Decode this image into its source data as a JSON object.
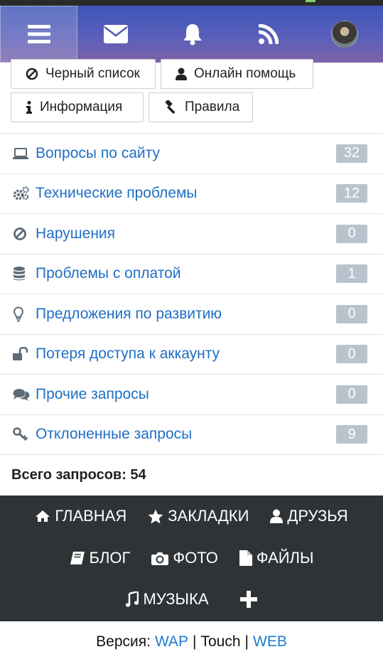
{
  "topbar": {
    "items": [
      {
        "icon": "menu-icon",
        "active": true
      },
      {
        "icon": "envelope-icon"
      },
      {
        "icon": "bell-icon"
      },
      {
        "icon": "rss-icon"
      },
      {
        "icon": "avatar"
      }
    ],
    "gradient_start": "#3d55b8",
    "gradient_end": "#7d63a8"
  },
  "buttons": {
    "blacklist": "Черный список",
    "online_help": "Онлайн помощь",
    "info": "Информация",
    "rules": "Правила"
  },
  "categories": [
    {
      "label": "Вопросы по сайту",
      "count": "32",
      "icon": "laptop-icon"
    },
    {
      "label": "Технические проблемы",
      "count": "12",
      "icon": "gears-icon"
    },
    {
      "label": "Нарушения",
      "count": "0",
      "icon": "ban-icon"
    },
    {
      "label": "Проблемы с оплатой",
      "count": "1",
      "icon": "database-icon"
    },
    {
      "label": "Предложения по развитию",
      "count": "0",
      "icon": "lightbulb-icon"
    },
    {
      "label": "Потеря доступа к аккаунту",
      "count": "0",
      "icon": "unlock-icon"
    },
    {
      "label": "Прочие запросы",
      "count": "0",
      "icon": "comments-icon"
    },
    {
      "label": "Отклоненные запросы",
      "count": "9",
      "icon": "key-icon"
    }
  ],
  "total": "Всего запросов: 54",
  "footer_nav": {
    "home": "ГЛАВНАЯ",
    "bookmarks": "ЗАКЛАДКИ",
    "friends": "ДРУЗЬЯ",
    "blog": "БЛОГ",
    "photo": "ФОТО",
    "files": "ФАЙЛЫ",
    "music": "МУЗЫКА"
  },
  "version": {
    "label": "Версия:",
    "wap": "WAP",
    "sep1": "|",
    "touch": "Touch",
    "sep2": "|",
    "web": "WEB"
  },
  "colors": {
    "link": "#1f6fc5",
    "badge": "#b8c3cd",
    "footer_bg": "#2f3336"
  }
}
